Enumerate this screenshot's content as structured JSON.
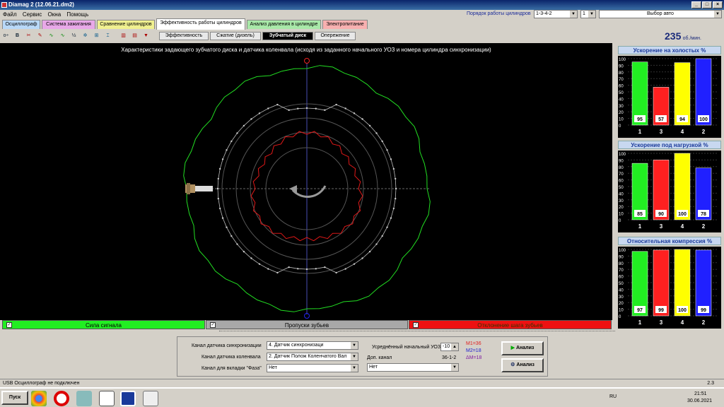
{
  "window": {
    "title": "Diamag 2 (12.06.21.dm2)"
  },
  "menu": [
    "Файл",
    "Сервис",
    "Окна",
    "Помощь"
  ],
  "firing_order": {
    "label": "Порядок работы цилиндров",
    "value": "1-3-4-2",
    "cyl": "1",
    "mode": "Выбор авто"
  },
  "tabs": [
    {
      "label": "Осциллограф",
      "color": "#b8d8f8"
    },
    {
      "label": "Система зажигания",
      "color": "#e8a8e8"
    },
    {
      "label": "Сравнение цилиндров",
      "color": "#f0f090"
    },
    {
      "label": "Эффективность работы цилиндров",
      "color": "#ffffff"
    },
    {
      "label": "Анализ давления в цилиндре",
      "color": "#a8e8a8"
    },
    {
      "label": "Электропитание",
      "color": "#f8b0b0"
    }
  ],
  "subtabs": [
    "Эффективность",
    "Сжатие (дизель)",
    "Зубчатый диск",
    "Опережение"
  ],
  "rpm": {
    "value": "235",
    "unit": "об./мин."
  },
  "plot": {
    "title": "Характеристики задающего зубчатого диска и датчика коленвала (исходя из заданного начального УОЗ и номера цилиндра синхронизации)"
  },
  "legend": [
    {
      "label": "Сила сигнала",
      "color": "#22ee22",
      "checked": true
    },
    {
      "label": "Пропуски зубьев",
      "color": "#a8a8a8",
      "checked": true
    },
    {
      "label": "Отклонение шага зубьев",
      "color": "#ee1111",
      "checked": true
    }
  ],
  "right_panels": [
    {
      "title": "Ускорение на холостых %",
      "cyls": [
        "1",
        "3",
        "4",
        "2"
      ],
      "values": [
        95,
        57,
        94,
        100
      ],
      "colors": [
        "#22ee22",
        "#ff2020",
        "#ffff00",
        "#2020ff"
      ]
    },
    {
      "title": "Ускорение под нагрузкой %",
      "cyls": [
        "1",
        "3",
        "4",
        "2"
      ],
      "values": [
        85,
        90,
        100,
        78
      ],
      "colors": [
        "#22ee22",
        "#ff2020",
        "#ffff00",
        "#2020ff"
      ]
    },
    {
      "title": "Относительная компрессия %",
      "cyls": [
        "1",
        "3",
        "4",
        "2"
      ],
      "values": [
        97,
        99,
        100,
        99
      ],
      "colors": [
        "#22ee22",
        "#ff2020",
        "#ffff00",
        "#2020ff"
      ]
    }
  ],
  "axis_ticks": [
    "100",
    "90",
    "80",
    "70",
    "60",
    "50",
    "40",
    "30",
    "20",
    "10",
    "0"
  ],
  "bottom": {
    "sync_label": "Канал датчика синхронизации",
    "sync_value": "4. Датчик синхронизаци",
    "crank_label": "Канал датчика коленвала",
    "crank_value": "2. Датчик Полож Коленчатого Вал",
    "phase_label": "Канал для вкладки \"Фаза\"",
    "phase_value": "Нет",
    "uoz_label": "Усреднённый начальный УОЗ",
    "uoz_value": "-10",
    "dop_label": "Доп. канал",
    "dop_value": "Нет",
    "wheel": "36-1-2",
    "m1": "M1=36",
    "m2": "M2=18",
    "dm": "ΔM=18",
    "analyze1": "Анализ",
    "analyze2": "Анализ"
  },
  "status": {
    "left": "USB Осциллограф не подключен",
    "right": "2.3"
  },
  "taskbar": {
    "start": "Пуск",
    "lang": "RU",
    "time": "21:51",
    "date": "30.06.2021"
  }
}
